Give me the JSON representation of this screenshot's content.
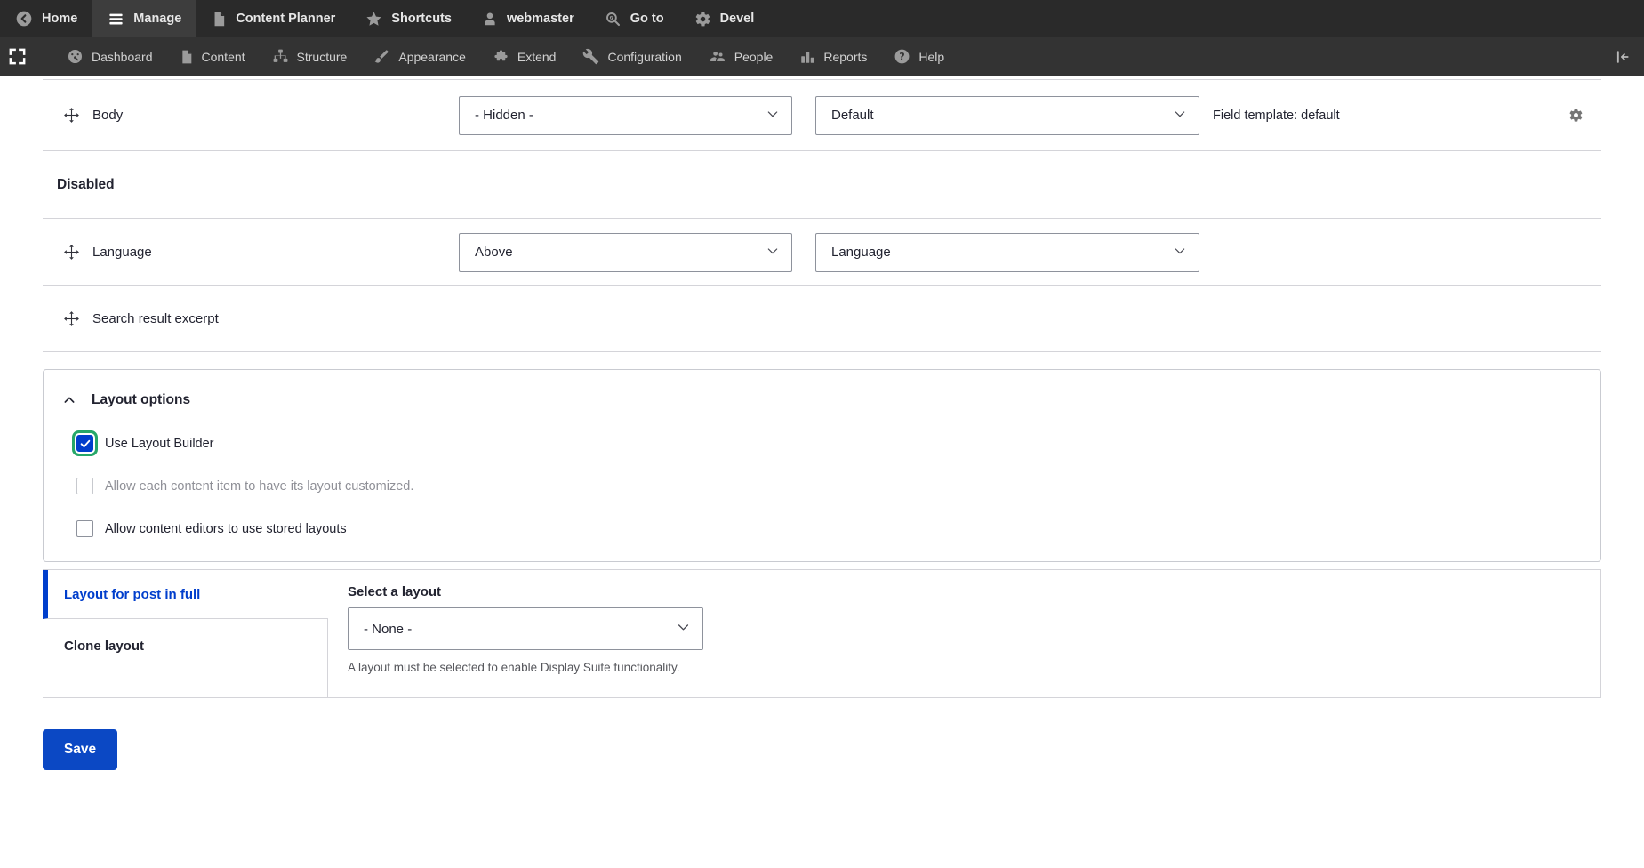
{
  "colors": {
    "toolbar_top_bg": "#2a2a2a",
    "toolbar_admin_bg": "#333333",
    "primary_blue": "#003ecc",
    "focus_green": "#26a769",
    "row_border": "#d4d4d9",
    "select_border": "#8e929c",
    "text": "#222330",
    "muted_text": "#8f9097"
  },
  "toolbar_top": {
    "items": [
      {
        "label": "Home",
        "icon": "back-arrow"
      },
      {
        "label": "Manage",
        "icon": "hamburger",
        "active": true
      },
      {
        "label": "Content Planner",
        "icon": "file"
      },
      {
        "label": "Shortcuts",
        "icon": "star"
      },
      {
        "label": "webmaster",
        "icon": "user"
      },
      {
        "label": "Go to",
        "icon": "search"
      },
      {
        "label": "Devel",
        "icon": "gear"
      }
    ]
  },
  "toolbar_admin": {
    "items": [
      {
        "label": "Dashboard",
        "icon": "gauge"
      },
      {
        "label": "Content",
        "icon": "file"
      },
      {
        "label": "Structure",
        "icon": "sitemap"
      },
      {
        "label": "Appearance",
        "icon": "brush"
      },
      {
        "label": "Extend",
        "icon": "puzzle"
      },
      {
        "label": "Configuration",
        "icon": "wrench"
      },
      {
        "label": "People",
        "icon": "people"
      },
      {
        "label": "Reports",
        "icon": "bar-chart"
      },
      {
        "label": "Help",
        "icon": "question"
      }
    ]
  },
  "fields": {
    "body_row": {
      "label": "Body",
      "region_value": "- Hidden -",
      "template_value": "Default",
      "template_info": "Field template: default"
    },
    "disabled_heading": "Disabled",
    "language_row": {
      "label": "Language",
      "region_value": "Above",
      "template_value": "Language"
    },
    "search_row": {
      "label": "Search result excerpt"
    }
  },
  "layout_options": {
    "legend": "Layout options",
    "checkbox_use_layout_builder": {
      "label": "Use Layout Builder",
      "checked": true
    },
    "checkbox_allow_custom": {
      "label": "Allow each content item to have its layout customized.",
      "checked": false,
      "disabled": true
    },
    "checkbox_stored_layouts": {
      "label": "Allow content editors to use stored layouts",
      "checked": false
    }
  },
  "vertical_tabs": {
    "tab_layout": {
      "label": "Layout for post in full",
      "active": true
    },
    "tab_clone": {
      "label": "Clone layout"
    },
    "pane": {
      "label": "Select a layout",
      "select_value": "- None -",
      "description": "A layout must be selected to enable Display Suite functionality."
    }
  },
  "actions": {
    "save_label": "Save"
  }
}
